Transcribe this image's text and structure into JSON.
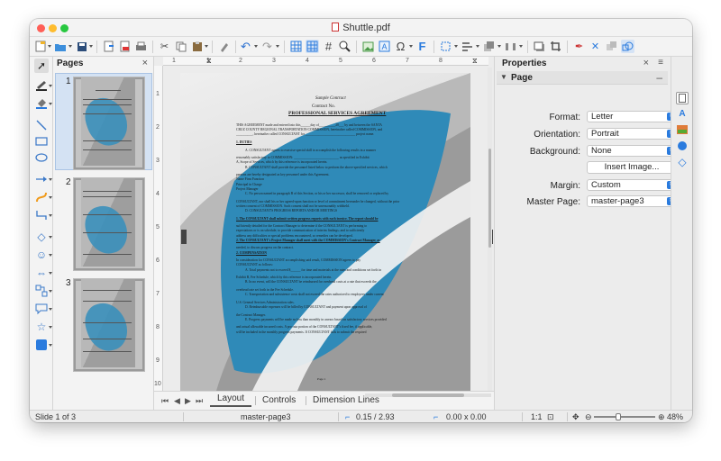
{
  "window": {
    "title": "Shuttle.pdf",
    "traffic_lights": {
      "close": "#ff5f57",
      "minimize": "#febc2e",
      "zoom": "#28c840"
    }
  },
  "toolbar": {
    "icons": [
      "new-document-icon",
      "open-folder-icon",
      "save-icon",
      "export-icon",
      "export-pdf-icon",
      "print-icon",
      "cut-icon",
      "copy-icon",
      "paste-icon",
      "clone-formatting-icon",
      "undo-icon",
      "redo-icon",
      "grid-icon",
      "display-grid-icon",
      "helplines-icon",
      "zoom-pan-icon",
      "insert-image-icon",
      "insert-textbox-icon",
      "insert-special-character-icon",
      "fontwork-icon",
      "transformations-icon",
      "align-icon",
      "arrange-icon",
      "distribute-icon",
      "shadow-icon",
      "crop-icon",
      "toggle-points-icon",
      "toggle-glue-points-icon",
      "toggle-extrusion-icon"
    ]
  },
  "pages_panel": {
    "title": "Pages",
    "pages": [
      {
        "number": "1"
      },
      {
        "number": "2"
      },
      {
        "number": "3"
      }
    ]
  },
  "document": {
    "heading_italic": "Sample Contract",
    "contract_no": "Contract No.",
    "heading": "PROFESSIONAL SERVICES AGREEMENT",
    "page_footer": "Page 1",
    "blocks": [
      "THIS AGREEMENT made and entered into this______day of__________20___ by and between the SANTA",
      "CRUZ COUNTY REGIONAL TRANSPORTATION COMMISSION, hereinafter called COMMISSION, and",
      "__________, hereinafter called CONSULTANT for ______________________________ project name.",
      "1.   DUTIES",
      "A.  CONSULTANT agrees to exercise special skill to accomplish the following results in a manner",
      "reasonably satisfactory to COMMISSION: ___________________________ as specified in Exhibit",
      "A, Scope of Services, which by this reference is incorporated herein.",
      "B.  CONSULTANT shall provide the personnel listed below to perform the above-specified services, which",
      "persons are hereby designated as key personnel under this Agreement.",
      "Name                         Firm                                    Function",
      "                                                                        Principal in Charge",
      "                                                                        Project Manager",
      "C.  No person named in paragraph B of this Section, or his or her successor, shall be removed or replaced by",
      "CONSULTANT, nor shall his or her agreed-upon function or level of commitment hereunder be changed, without the prior",
      "written consent of COMMISSION. Such consent shall not be unreasonably withheld.",
      "D.  CONSULTANT'S PROGRESS REPORTS AND/OR MEETINGS",
      "1.  The CONSULTANT shall submit written progress reports with each invoice. The report should be",
      "sufficiently detailed for the Contract Manager to determine if the CONSULTANT is performing to",
      "expectations or is on schedule; to provide communication of interim findings; and to sufficiently",
      "address any difficulties or special problems encountered, so remedies can be developed.",
      "2.  The CONSULTANT's Project Manager shall meet with the COMMISSION's Contract Manager, as",
      "needed, to discuss progress on the contract.",
      "2.   COMPENSATION",
      "In consideration for CONSULTANT accomplishing said result, COMMISSION agrees to pay",
      "CONSULTANT as follows:",
      "A.  Total payments not to exceed $______ for time and materials at the rates and conditions set forth in",
      "Exhibit B, Fee Schedule, which by this reference is incorporated herein.",
      "B.  In no event, will the CONSULTANT be reimbursed for overhead costs at a rate that exceeds the",
      "overhead rate set forth in the Fee Schedule.",
      "C.  Transportation and subsistence costs shall not exceed the rates authorized to employees under current",
      "U.S. General Services Administration rules.",
      "D.  Reimbursable expenses will be billed by CONSULTANT and payment upon approval of",
      "the Contract Manager.",
      "E.  Progress payments will be made no less than monthly in arrears based on satisfactory services provided",
      "and actual allowable incurred costs. A pro rata portion of the CONSULTANT's fixed fee, if applicable,",
      "will be included in the monthly progress payments. If CONSULTANT fails to submit the required"
    ]
  },
  "ruler": {
    "h_numbers": [
      "1",
      "1",
      "2",
      "3",
      "4",
      "5",
      "6",
      "7",
      "8"
    ],
    "v_numbers": [
      "1",
      "2",
      "3",
      "4",
      "5",
      "6",
      "7",
      "8",
      "9",
      "10"
    ]
  },
  "bottom_tabs": {
    "tabs": [
      "Layout",
      "Controls",
      "Dimension Lines"
    ],
    "active": "Layout"
  },
  "properties": {
    "title": "Properties",
    "section": "Page",
    "format_label": "Format:",
    "format_value": "Letter",
    "orientation_label": "Orientation:",
    "orientation_value": "Portrait",
    "background_label": "Background:",
    "background_value": "None",
    "insert_image": "Insert Image...",
    "margin_label": "Margin:",
    "margin_value": "Custom",
    "master_label": "Master Page:",
    "master_value": "master-page3"
  },
  "statusbar": {
    "slide": "Slide 1 of 3",
    "master": "master-page3",
    "position": "0.15 / 2.93",
    "size": "0.00 x 0.00",
    "ratio": "1:1",
    "zoom": "48%"
  },
  "colors": {
    "accent": "#2a7bde",
    "shape_blue": "#2f8ab8"
  }
}
